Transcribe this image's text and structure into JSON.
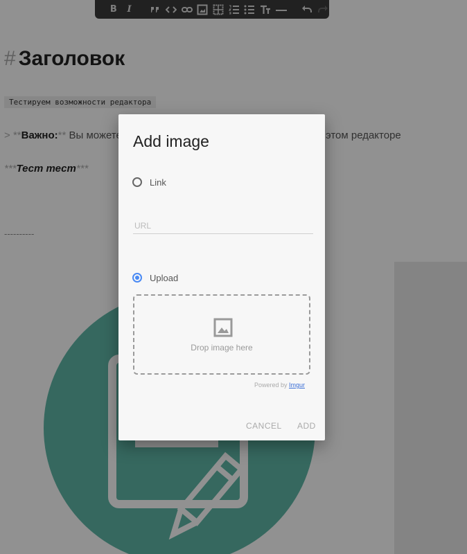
{
  "toolbar": {
    "items": [
      "bold-icon",
      "italic-icon",
      "quote-icon",
      "code-icon",
      "link-icon",
      "image-icon",
      "table-icon",
      "ordered-list-icon",
      "unordered-list-icon",
      "heading-icon",
      "horizontal-rule-icon",
      "undo-icon",
      "redo-icon"
    ],
    "bold": "B",
    "italic": "I"
  },
  "editor": {
    "heading_marker": "#",
    "heading": "Заголовок",
    "code_line": "Тестируем возможности редактора",
    "quote_marker": ">",
    "quote_bold_open": "**",
    "quote_bold": "Важно:",
    "quote_bold_close": "**",
    "quote_text": "Вы можете",
    "quote_text_end": "этом редакторе",
    "emphasis_open": "***",
    "emphasis_text": "Тест тест",
    "emphasis_close": "***",
    "hr": "----------"
  },
  "dialog": {
    "title": "Add image",
    "link_label": "Link",
    "url_placeholder": "URL",
    "upload_label": "Upload",
    "drop_text": "Drop image here",
    "powered_by": "Powered by",
    "powered_by_link": "Imgur",
    "cancel": "CANCEL",
    "add": "ADD",
    "selected_option": "Upload"
  },
  "colors": {
    "accent": "#4a8af4",
    "teal": "#5fb8a7",
    "overlay": "rgba(0,0,0,0.43)"
  }
}
